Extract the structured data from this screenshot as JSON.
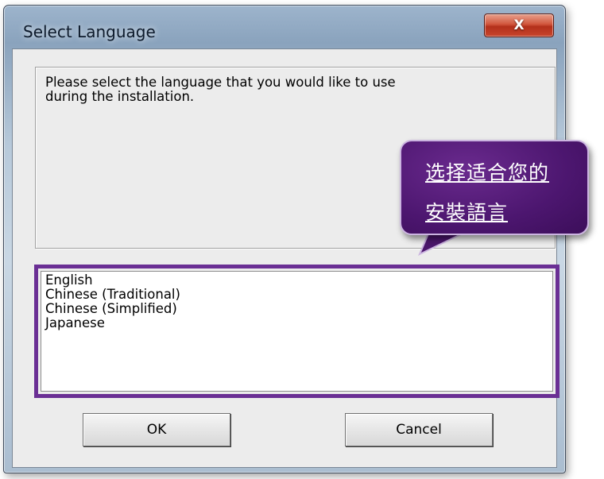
{
  "window": {
    "title": "Select Language",
    "close_label": "X"
  },
  "message": {
    "line1": "Please select the language that you would like to use",
    "line2": "during the installation."
  },
  "languages": {
    "items": [
      "English",
      "Chinese (Traditional)",
      "Chinese (Simplified)",
      "Japanese"
    ]
  },
  "buttons": {
    "ok_label": "OK",
    "cancel_label": "Cancel"
  },
  "callout": {
    "line1": "选择适合您的",
    "line2": "安裝語言"
  },
  "colors": {
    "highlight": "#6a2f94",
    "callout_fill": "#4c166f",
    "close_button": "#c8452c"
  }
}
